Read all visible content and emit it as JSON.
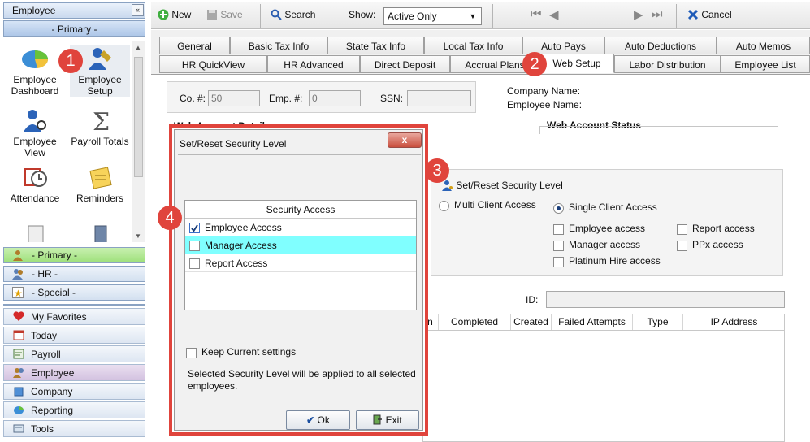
{
  "sidebar": {
    "title": "Employee",
    "collapse_glyph": "«",
    "section": "- Primary -",
    "tiles": [
      {
        "label1": "Employee",
        "label2": "Dashboard",
        "icon": "employee-dashboard-icon"
      },
      {
        "label1": "Employee",
        "label2": "Setup",
        "icon": "employee-setup-icon"
      },
      {
        "label1": "Employee",
        "label2": "View",
        "icon": "employee-view-icon"
      },
      {
        "label1": "Payroll Totals",
        "label2": "",
        "icon": "payroll-totals-icon"
      },
      {
        "label1": "Attendance",
        "label2": "",
        "icon": "attendance-icon"
      },
      {
        "label1": "Reminders",
        "label2": "",
        "icon": "reminders-icon"
      }
    ],
    "groups": [
      "- Primary -",
      "- HR -",
      "- Special -"
    ],
    "nav": [
      "My Favorites",
      "Today",
      "Payroll",
      "Employee",
      "Company",
      "Reporting",
      "Tools"
    ]
  },
  "toolbar": {
    "new": "New",
    "save": "Save",
    "search": "Search",
    "show_label": "Show:",
    "show_value": "Active Only",
    "cancel": "Cancel"
  },
  "tabs_row1": [
    "General",
    "Basic Tax Info",
    "State Tax Info",
    "Local Tax Info",
    "Auto Pays",
    "Auto Deductions",
    "Auto Memos"
  ],
  "tabs_row2": [
    "HR QuickView",
    "HR Advanced",
    "Direct Deposit",
    "Accrual Plans",
    "Web Setup",
    "Labor Distribution",
    "Employee List"
  ],
  "header": {
    "co_label": "Co. #:",
    "co_value": "50",
    "emp_label": "Emp. #:",
    "emp_value": "0",
    "ssn_label": "SSN:",
    "ssn_value": "",
    "company_name_label": "Company Name:",
    "employee_name_label": "Employee Name:"
  },
  "web_account": {
    "details_title": "Web Account Details",
    "status_title": "Web Account Status",
    "set_reset_link": "Set/Reset Security Level",
    "multi_client": "Multi Client Access",
    "single_client": "Single Client Access",
    "options": [
      "Employee access",
      "Report access",
      "Manager access",
      "PPx access",
      "Platinum Hire access"
    ],
    "id_label": "ID:"
  },
  "log_columns": [
    "n",
    "Completed",
    "Created",
    "Failed Attempts",
    "Type",
    "IP Address"
  ],
  "dialog": {
    "title": "Set/Reset Security Level",
    "close": "x",
    "column_header": "Security Access",
    "rows": [
      {
        "label": "Employee Access",
        "checked": true
      },
      {
        "label": "Manager Access",
        "checked": false
      },
      {
        "label": "Report Access",
        "checked": false
      }
    ],
    "keep_label": "Keep Current settings",
    "note": "Selected Security Level will be applied to all selected employees.",
    "ok": "Ok",
    "exit": "Exit"
  },
  "badges": [
    "1",
    "2",
    "3",
    "4"
  ],
  "colors": {
    "accent_red": "#e0443c",
    "highlight_row": "#80ffff",
    "primary_group": "#9ee07a"
  }
}
